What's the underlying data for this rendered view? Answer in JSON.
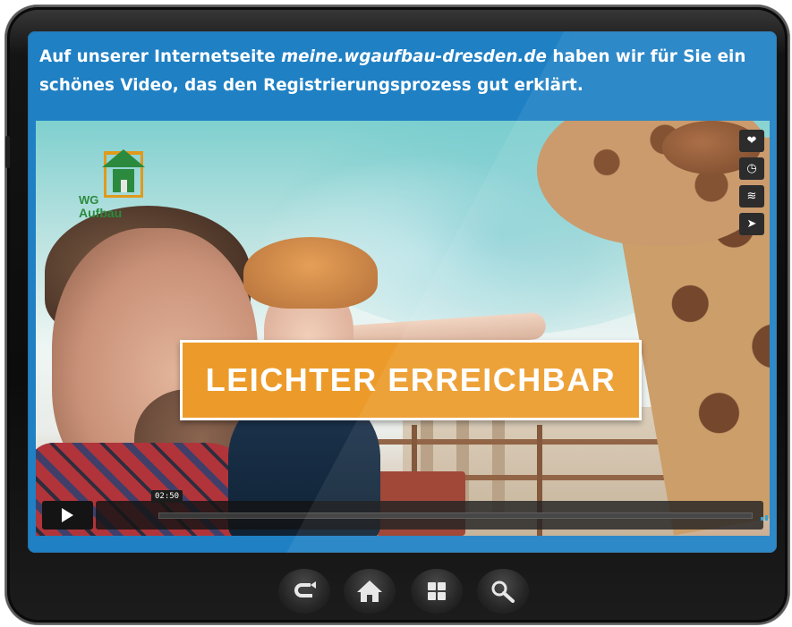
{
  "caption": {
    "before": "Auf unserer Internetseite ",
    "link": "meine.wgaufbau-dresden.de",
    "after": " haben wir für Sie ein schönes Video, das den Registrierungsprozess gut erklärt."
  },
  "video": {
    "logo_line1": "WG",
    "logo_line2": "Aufbau",
    "banner_text": "LEICHTER ERREICHBAR",
    "time_label": "02:50",
    "progress_fraction": 0.0,
    "side_actions": [
      "heart-icon",
      "clock-icon",
      "layers-icon",
      "send-icon"
    ]
  },
  "controls": {
    "play": "play-icon",
    "volume": "volume-icon",
    "settings": "gear-icon",
    "fullscreen": "fullscreen-icon"
  },
  "bottom_nav": [
    "back-icon",
    "home-icon",
    "apps-icon",
    "search-icon"
  ],
  "colors": {
    "screen_blue": "#1f80c4",
    "banner_orange": "#ec9b2b",
    "logo_green": "#2c8a3e",
    "volume_blue": "#1f9bd8"
  }
}
